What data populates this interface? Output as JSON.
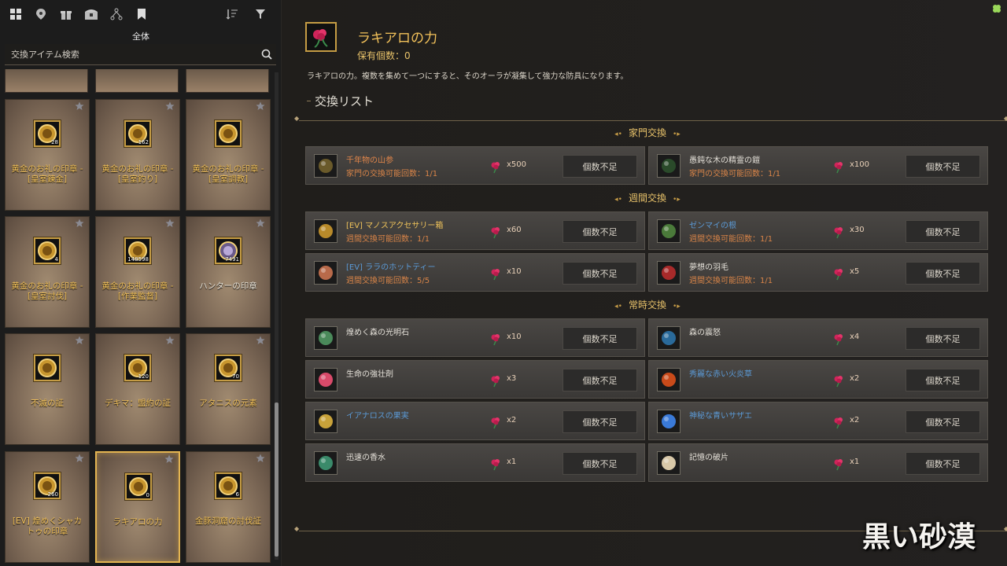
{
  "left": {
    "category": "全体",
    "search": {
      "placeholder": "交換アイテム検索",
      "value": ""
    },
    "cards": [
      {
        "name": "黄金のお礼の印章 - [皇室錬金]",
        "count": "28",
        "style": "gold"
      },
      {
        "name": "黄金のお礼の印章 - [皇室釣り]",
        "count": "162",
        "style": "gold"
      },
      {
        "name": "黄金のお礼の印章 - [皇室調教]",
        "count": "",
        "style": "gold"
      },
      {
        "name": "黄金のお礼の印章 - [皇室討伐]",
        "count": "4",
        "style": "gold"
      },
      {
        "name": "黄金のお礼の印章 - [作業監督]",
        "count": "148598",
        "style": "gold"
      },
      {
        "name": "ハンターの印章",
        "count": "7491",
        "style": "white"
      },
      {
        "name": "不滅の証",
        "count": "",
        "style": "gold"
      },
      {
        "name": "デキマ：盟約の証",
        "count": "120",
        "style": "gold"
      },
      {
        "name": "アタニスの元素",
        "count": "70",
        "style": "gold"
      },
      {
        "name": "[EV] 煌めくシャカトゥの印章",
        "count": "260",
        "style": "gold"
      },
      {
        "name": "ラキアロの力",
        "count": "0",
        "style": "gold",
        "selected": true
      },
      {
        "name": "金豚洞窟の討伐証",
        "count": "6",
        "style": "gold"
      }
    ]
  },
  "header": {
    "title": "ラキアロの力",
    "owned": "保有個数：0",
    "description": "ラキアロの力。複数を集めて一つにすると、そのオーラが凝集して強力な防具になります。",
    "list_title": "交換リスト"
  },
  "sections": [
    {
      "title": "家門交換",
      "rows": [
        {
          "name": "千年物の山参",
          "name_color": "orange",
          "sub": "家門の交換可能回数：1/1",
          "cost": "x500",
          "button": "個数不足"
        },
        {
          "name": "愚鈍な木の精霊の鎧",
          "name_color": "white",
          "sub": "家門の交換可能回数：1/1",
          "cost": "x100",
          "button": "個数不足"
        }
      ]
    },
    {
      "title": "週間交換",
      "rows": [
        {
          "name": "[EV] マノスアクセサリー箱",
          "name_color": "gold",
          "sub": "週間交換可能回数：1/1",
          "cost": "x60",
          "button": "個数不足"
        },
        {
          "name": "ゼンマイの根",
          "name_color": "blue",
          "sub": "週間交換可能回数：1/1",
          "cost": "x30",
          "button": "個数不足"
        },
        {
          "name": "[EV] ララのホットティー",
          "name_color": "blue",
          "sub": "週間交換可能回数：5/5",
          "cost": "x10",
          "button": "個数不足"
        },
        {
          "name": "夢想の羽毛",
          "name_color": "white",
          "sub": "週間交換可能回数：1/1",
          "cost": "x5",
          "button": "個数不足"
        }
      ]
    },
    {
      "title": "常時交換",
      "rows": [
        {
          "name": "煌めく森の光明石",
          "name_color": "white",
          "sub": "",
          "cost": "x10",
          "button": "個数不足"
        },
        {
          "name": "森の震怒",
          "name_color": "white",
          "sub": "",
          "cost": "x4",
          "button": "個数不足"
        },
        {
          "name": "生命の強壮剤",
          "name_color": "white",
          "sub": "",
          "cost": "x3",
          "button": "個数不足"
        },
        {
          "name": "秀麗な赤い火炎草",
          "name_color": "blue",
          "sub": "",
          "cost": "x2",
          "button": "個数不足"
        },
        {
          "name": "イアナロスの果実",
          "name_color": "blue",
          "sub": "",
          "cost": "x2",
          "button": "個数不足"
        },
        {
          "name": "神秘な青いサザエ",
          "name_color": "blue",
          "sub": "",
          "cost": "x2",
          "button": "個数不足"
        },
        {
          "name": "迅速の香水",
          "name_color": "white",
          "sub": "",
          "cost": "x1",
          "button": "個数不足"
        },
        {
          "name": "記憶の破片",
          "name_color": "white",
          "sub": "",
          "cost": "x1",
          "button": "個数不足"
        }
      ]
    }
  ],
  "logo": "黒い砂漠",
  "icons": {
    "top": [
      "grid-icon",
      "map-pin-icon",
      "gift-icon",
      "chest-icon",
      "nodes-icon",
      "bookmark-icon"
    ],
    "sort": [
      "sort-icon",
      "filter-icon"
    ]
  },
  "colors": {
    "gold": "#efc35a",
    "orange": "#e0854a",
    "blue": "#5b9ad6",
    "white": "#e4e0d8"
  }
}
